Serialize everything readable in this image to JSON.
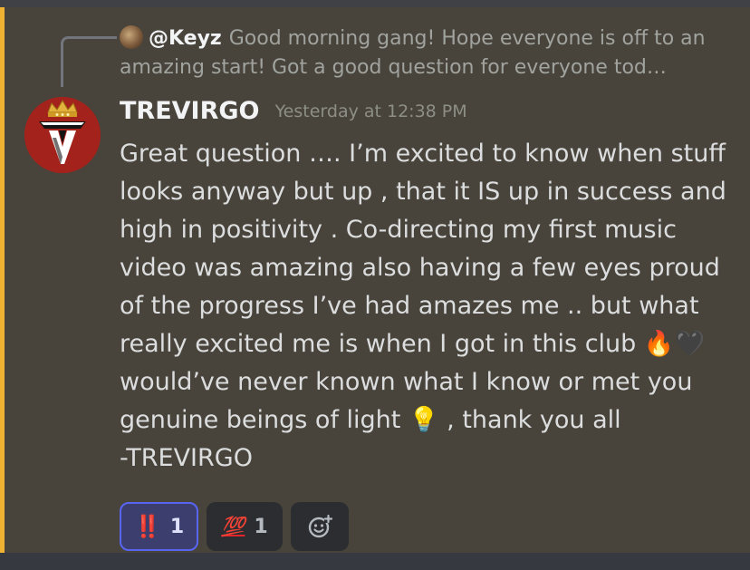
{
  "reply": {
    "author": "@Keyz",
    "text": "Good morning gang! Hope everyone is off to an amazing start! Got a good question for everyone tod…"
  },
  "message": {
    "author": "TREVIRGO",
    "timestamp": "Yesterday at 12:38 PM",
    "content": "Great question …. I’m excited to know when stuff looks anyway but up , that it IS up in success and high in positivity . Co-directing my first music video was amazing also having a few eyes proud of the progress I’ve had amazes me .. but what really excited me is when I got in this club 🔥🖤 would’ve never known what I know or met you genuine beings of light 💡 , thank you all\n-TREVIRGO"
  },
  "reactions": [
    {
      "emoji": "‼️",
      "count": "1",
      "active": true
    },
    {
      "emoji": "💯",
      "count": "1",
      "active": false
    }
  ],
  "colors": {
    "highlight_bar": "#f0b232",
    "message_bg": "#48443b",
    "active_reaction_border": "#5865f2"
  }
}
